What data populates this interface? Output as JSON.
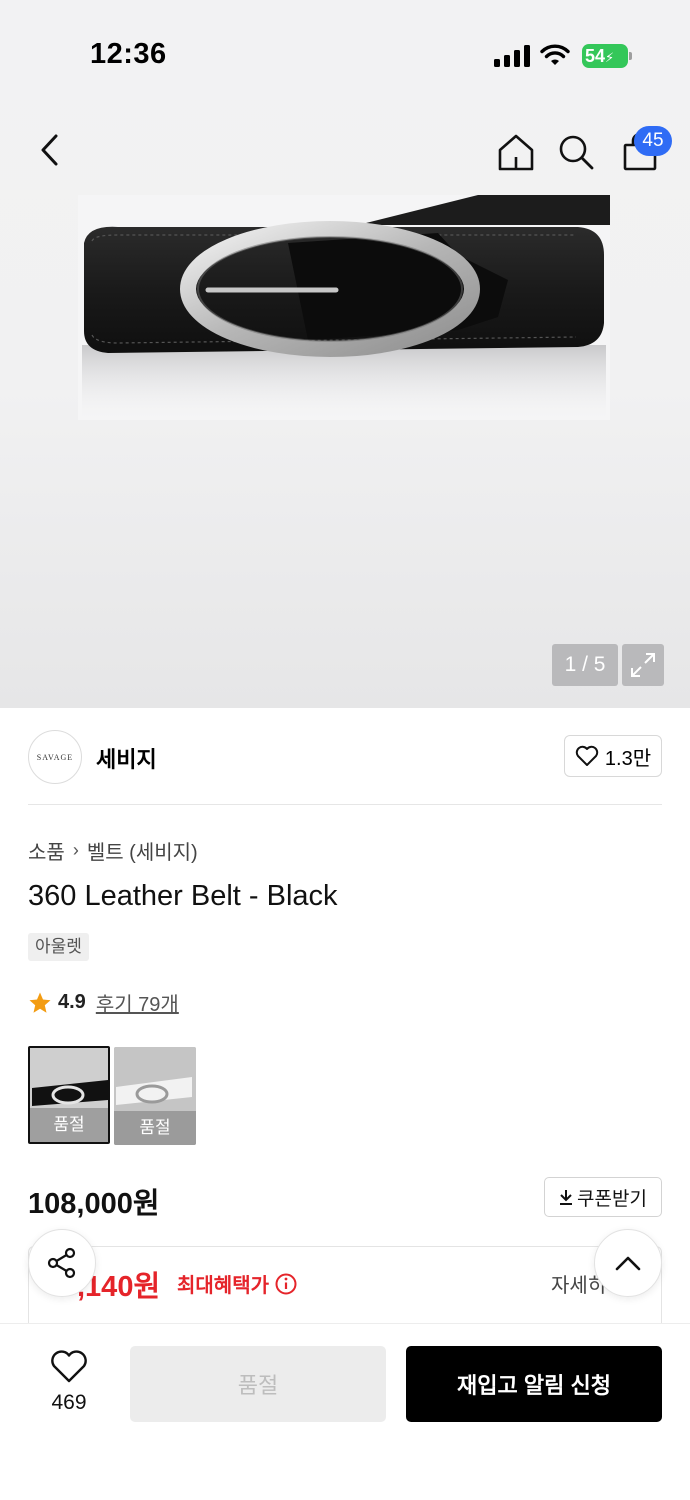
{
  "status_bar": {
    "time": "12:36",
    "battery": "54"
  },
  "header": {
    "cart_count": "45"
  },
  "gallery": {
    "counter": "1 / 5"
  },
  "brand": {
    "logo_text": "SAVAGE",
    "name": "세비지",
    "like_count": "1.3만"
  },
  "breadcrumb": {
    "category": "소품",
    "subcategory": "벨트 (세비지)"
  },
  "product": {
    "title": "360 Leather Belt - Black",
    "tag": "아울렛",
    "rating": "4.9",
    "reviews": "후기 79개",
    "swatches": [
      {
        "label": "품절",
        "color": "black"
      },
      {
        "label": "품절",
        "color": "white"
      }
    ],
    "price": "108,000원",
    "coupon_label": "쿠폰받기"
  },
  "benefit": {
    "price": ",140원",
    "label": "최대혜택가",
    "detail": "자세히"
  },
  "bottom_bar": {
    "wish_count": "469",
    "soldout_label": "품절",
    "restock_label": "재입고 알림 신청"
  },
  "colors": {
    "accent_red": "#e5242a",
    "badge_blue": "#2f6cf5",
    "battery_green": "#34c759"
  }
}
